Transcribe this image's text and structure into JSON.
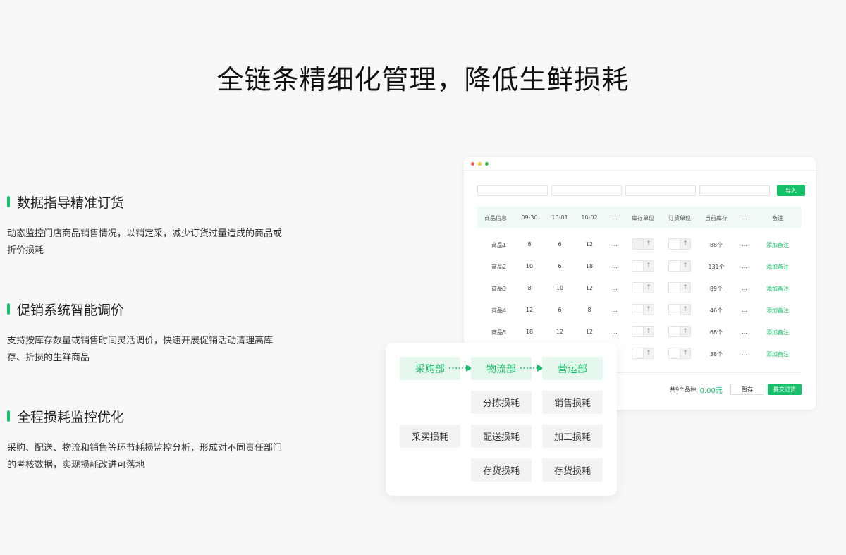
{
  "page": {
    "title": "全链条精细化管理，降低生鲜损耗"
  },
  "features": [
    {
      "title": "数据指导精准订货",
      "desc": "动态监控门店商品销售情况，以销定采，减少订货过量造成的商品或折价损耗"
    },
    {
      "title": "促销系统智能调价",
      "desc": "支持按库存数量或销售时间灵活调价，快速开展促销活动清理高库存、折损的生鲜商品"
    },
    {
      "title": "全程损耗监控优化",
      "desc": "采购、配送、物流和销售等环节耗损监控分析，形成对不同责任部门的考核数据，实现损耗改进可落地"
    }
  ],
  "colors": {
    "accent": "#18c06b",
    "dot_red": "#ff5f57",
    "dot_yellow": "#febc2e",
    "dot_green": "#28c840"
  },
  "table_card": {
    "import_label": "导入",
    "headers": [
      "商品信息",
      "09-30",
      "10-01",
      "10-02",
      "...",
      "库存单位",
      "订货单位",
      "当前库存",
      "...",
      "备注"
    ],
    "rows": [
      {
        "name": "商品1",
        "d1": "8",
        "d2": "6",
        "d3": "12",
        "more": "...",
        "stock": "88个",
        "more2": "...",
        "note": "添加备注"
      },
      {
        "name": "商品2",
        "d1": "10",
        "d2": "6",
        "d3": "18",
        "more": "...",
        "stock": "131个",
        "more2": "...",
        "note": "添加备注"
      },
      {
        "name": "商品3",
        "d1": "8",
        "d2": "10",
        "d3": "12",
        "more": "...",
        "stock": "89个",
        "more2": "...",
        "note": "添加备注"
      },
      {
        "name": "商品4",
        "d1": "12",
        "d2": "6",
        "d3": "8",
        "more": "...",
        "stock": "46个",
        "more2": "...",
        "note": "添加备注"
      },
      {
        "name": "商品5",
        "d1": "18",
        "d2": "12",
        "d3": "12",
        "more": "...",
        "stock": "68个",
        "more2": "...",
        "note": "添加备注"
      },
      {
        "name": "",
        "d1": "",
        "d2": "",
        "d3": "",
        "more": "",
        "stock": "38个",
        "more2": "...",
        "note": "添加备注"
      }
    ],
    "summary_text": "共9个品种,",
    "summary_amount": "0.00元",
    "draft_label": "暂存",
    "submit_label": "提交订货",
    "stepper_up": "↑"
  },
  "flow_card": {
    "departments": [
      "采购部",
      "物流部",
      "营运部"
    ],
    "losses": {
      "sorting": "分拣损耗",
      "sales": "销售损耗",
      "purchase": "采买损耗",
      "delivery": "配送损耗",
      "processing": "加工损耗",
      "inventory_a": "存货损耗",
      "inventory_b": "存货损耗"
    }
  }
}
